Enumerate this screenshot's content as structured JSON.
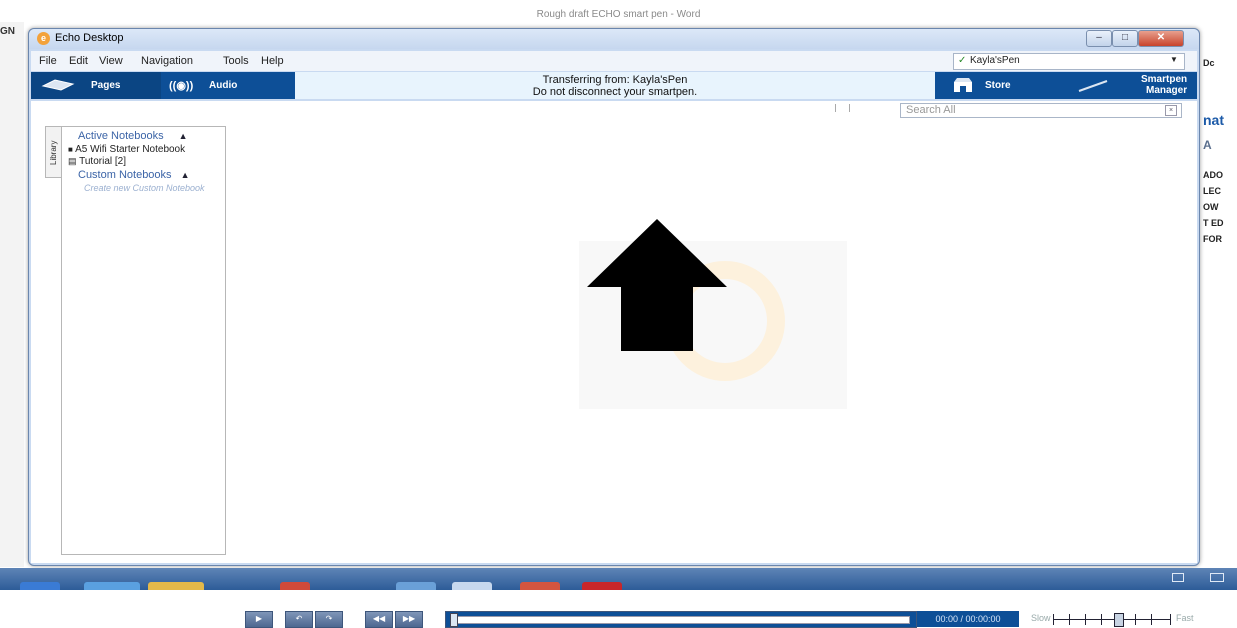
{
  "background_window": {
    "title": "Rough draft ECHO smart pen - Word",
    "left_fragment": "GN",
    "right_fragments": [
      "Dc",
      "nat",
      "A",
      "ADO",
      "LEC",
      "OW",
      "T ED",
      "FOR"
    ]
  },
  "window": {
    "title": "Echo Desktop",
    "app_icon": "e"
  },
  "menu": {
    "items": [
      "File",
      "Edit",
      "View",
      "Navigation",
      "Tools",
      "Help"
    ],
    "pen_selected": "Kayla'sPen"
  },
  "toolbar": {
    "pages_label": "Pages",
    "audio_label": "Audio",
    "store_label": "Store",
    "smartpen_manager_line1": "Smartpen",
    "smartpen_manager_line2": "Manager"
  },
  "status": {
    "line1": "Transferring from: Kayla'sPen",
    "line2": "Do not disconnect your smartpen."
  },
  "library": {
    "tab_label": "Library",
    "active_header": "Active Notebooks",
    "notebooks": [
      {
        "label": "A5 Wifi Starter Notebook"
      },
      {
        "label": "Tutorial [2]"
      }
    ],
    "custom_header": "Custom Notebooks",
    "create_link": "Create new Custom Notebook"
  },
  "search": {
    "placeholder": "Search All"
  },
  "playback": {
    "time": "00:00 / 00:00:00",
    "slow_label": "Slow",
    "fast_label": "Fast",
    "speed_level": 0.55
  },
  "colors": {
    "toolbar_blue": "#0d4f97",
    "status_bg": "#e8f4fd",
    "accent_orange": "#f3a23b"
  }
}
